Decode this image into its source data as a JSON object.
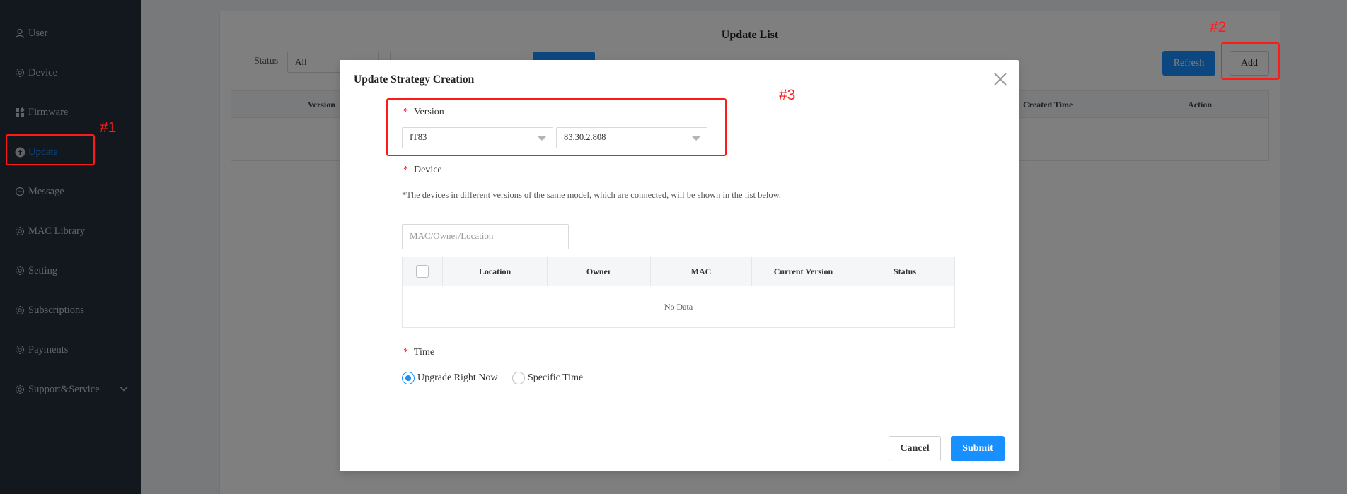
{
  "sidebar": {
    "items": [
      {
        "label": "User",
        "icon": "user-icon"
      },
      {
        "label": "Device",
        "icon": "gear-icon"
      },
      {
        "label": "Firmware",
        "icon": "grid-icon"
      },
      {
        "label": "Update",
        "icon": "upload-circle-icon"
      },
      {
        "label": "Message",
        "icon": "chat-icon"
      },
      {
        "label": "MAC Library",
        "icon": "gear-icon"
      },
      {
        "label": "Setting",
        "icon": "gear-icon"
      },
      {
        "label": "Subscriptions",
        "icon": "gear-icon"
      },
      {
        "label": "Payments",
        "icon": "gear-icon"
      },
      {
        "label": "Support&Service",
        "icon": "gear-icon"
      }
    ],
    "active_item": "Update"
  },
  "page": {
    "title": "Update List",
    "status_label": "Status",
    "status_value": "All",
    "refresh_label": "Refresh",
    "add_label": "Add",
    "table_headers": {
      "version": "Version",
      "created_time": "Created Time",
      "action": "Action"
    }
  },
  "modal": {
    "title": "Update Strategy Creation",
    "version_label": "Version",
    "model_value": "IT83",
    "firmware_value": "83.30.2.808",
    "device_label": "Device",
    "device_hint": "*The devices in different versions of the same model, which are connected, will be shown in the list below.",
    "search_placeholder": "MAC/Owner/Location",
    "table_headers": [
      "Location",
      "Owner",
      "MAC",
      "Current Version",
      "Status"
    ],
    "no_data": "No Data",
    "time_label": "Time",
    "time_options": [
      "Upgrade Right Now",
      "Specific Time"
    ],
    "time_selected": "Upgrade Right Now",
    "cancel_label": "Cancel",
    "submit_label": "Submit"
  },
  "annotations": [
    "#1",
    "#2",
    "#3"
  ],
  "colors": {
    "sidebar_bg": "#26303f",
    "primary": "#1890ff",
    "annotation": "#ff1a1a"
  }
}
